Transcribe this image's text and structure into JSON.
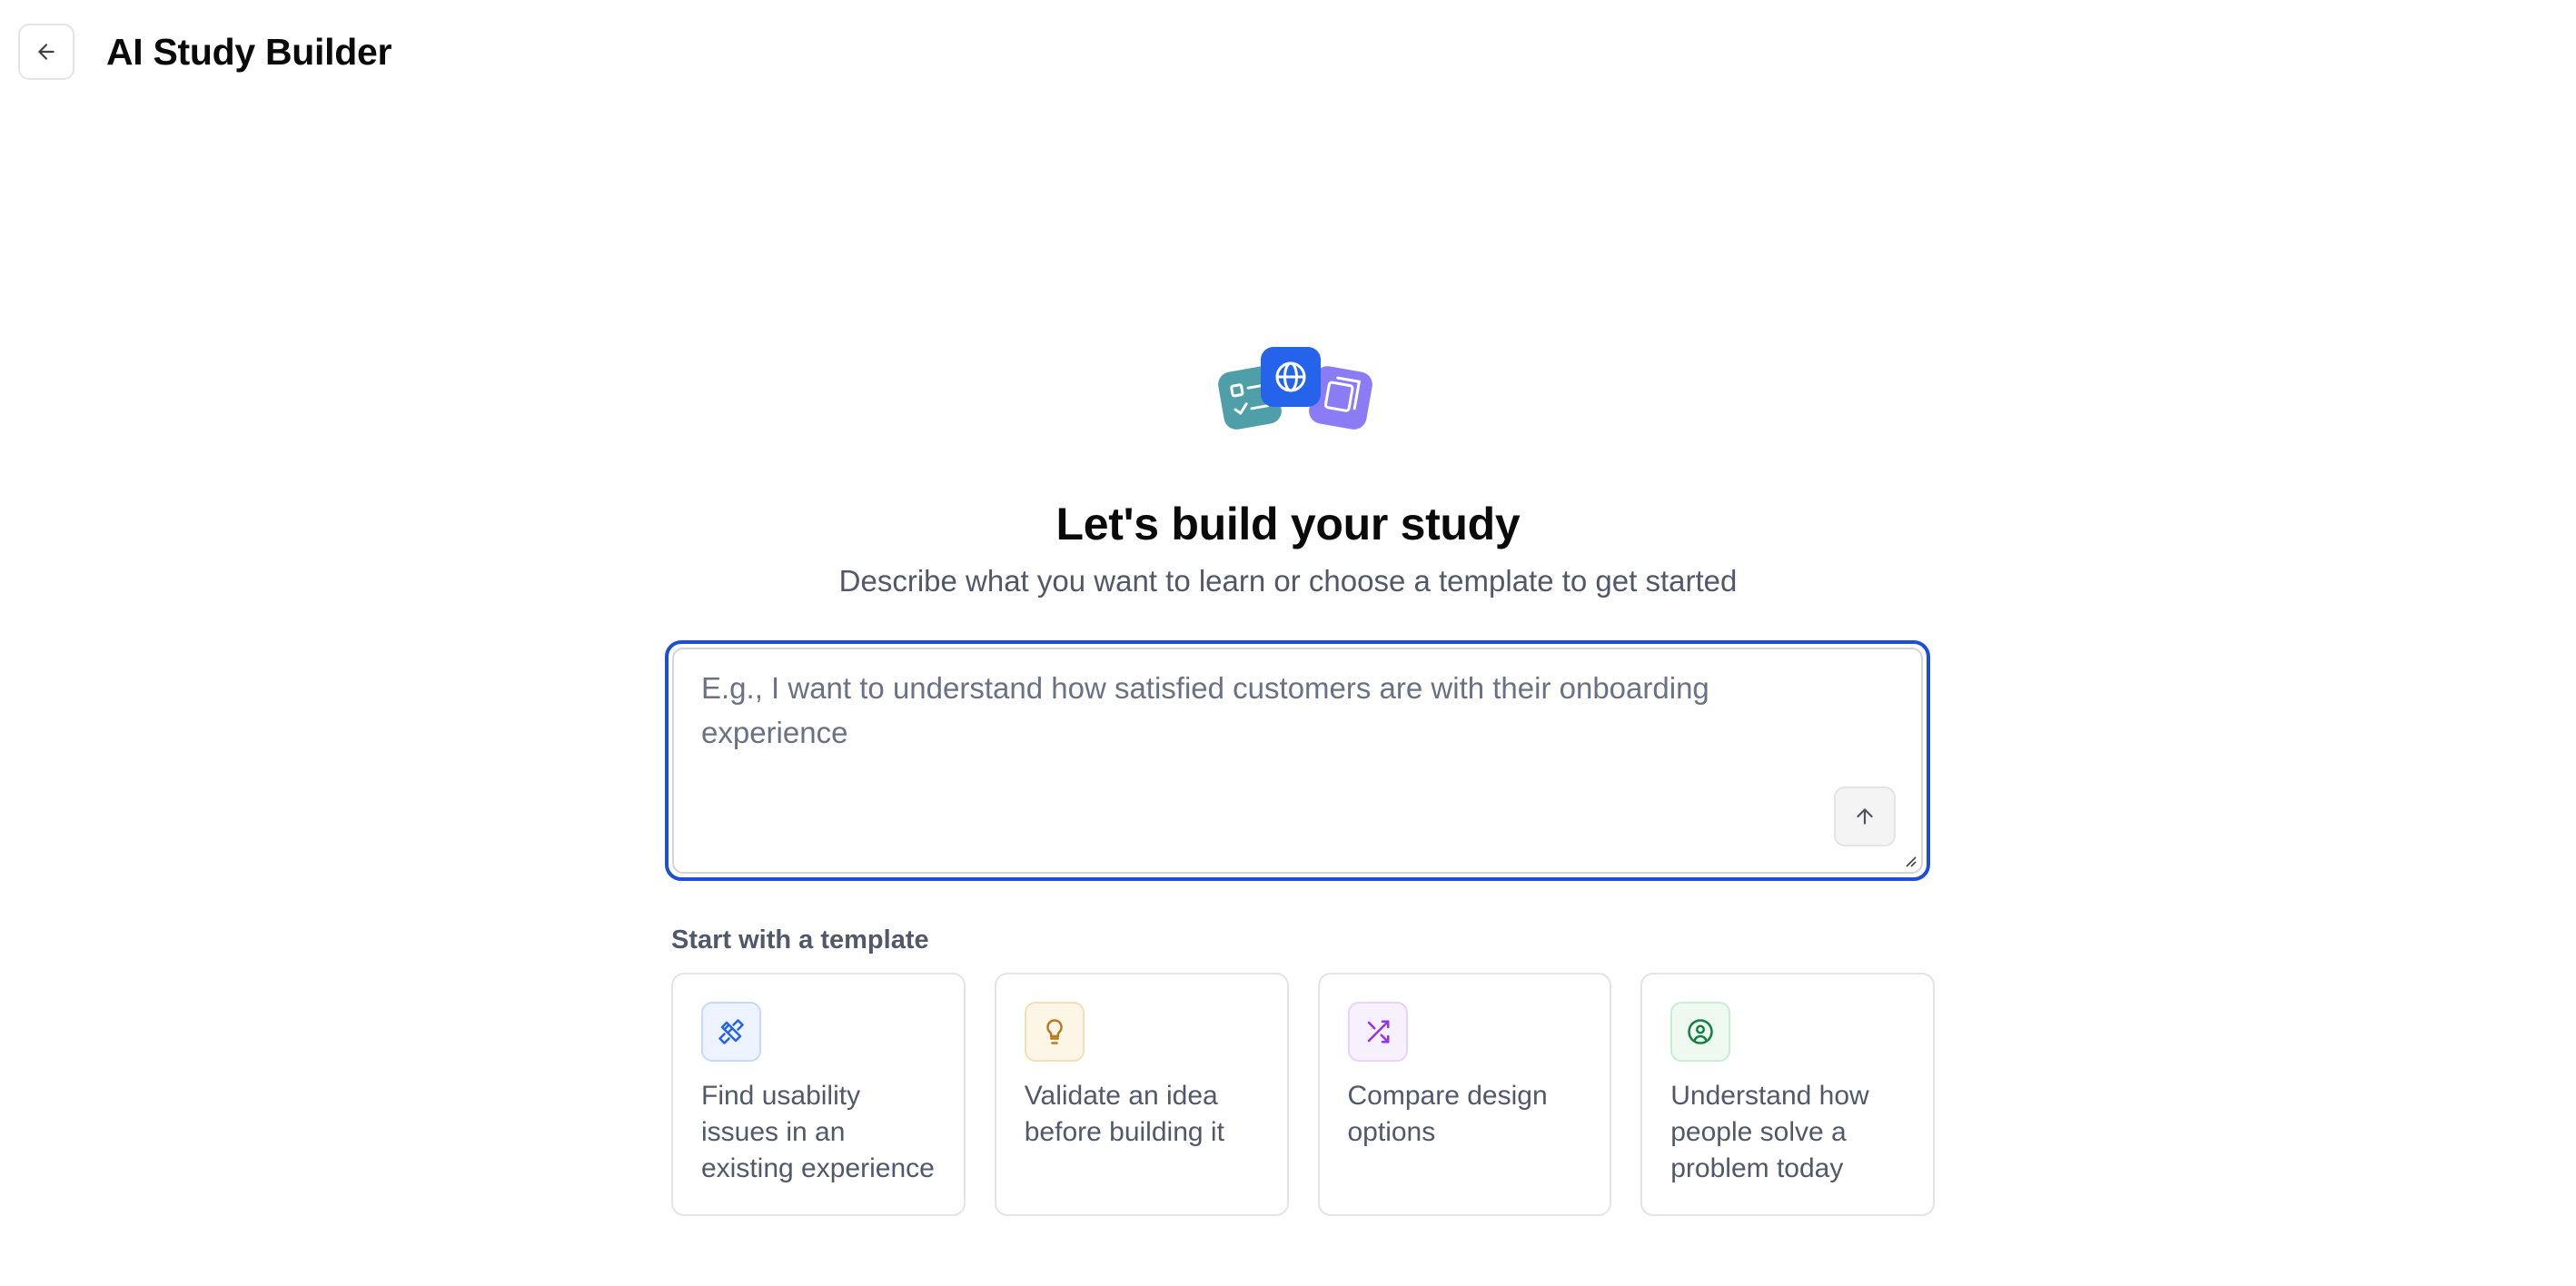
{
  "header": {
    "back_icon": "arrow-left-icon",
    "title": "AI Study Builder"
  },
  "hero": {
    "icons": [
      "checklist-icon",
      "globe-icon",
      "documents-icon"
    ],
    "colors": {
      "teal": "#4f9fa9",
      "blue": "#2563eb",
      "purple": "#8b7cf6"
    },
    "title": "Let's build your study",
    "subtitle": "Describe what you want to learn or choose a template to get started"
  },
  "prompt": {
    "value": "",
    "placeholder": "E.g., I want to understand how satisfied customers are with their onboarding experience",
    "submit_icon": "arrow-up-icon",
    "focus_color": "#1d4ed8"
  },
  "templates": {
    "label": "Start with a template",
    "items": [
      {
        "icon": "tools-icon",
        "label": "Find usability issues in an existing experience",
        "icon_color": "#2563eb",
        "bg": "#eef4ff",
        "border": "#c8d8fb"
      },
      {
        "icon": "lightbulb-icon",
        "label": "Validate an idea before building it",
        "icon_color": "#b7791f",
        "bg": "#fdf6e7",
        "border": "#f3dfb5"
      },
      {
        "icon": "shuffle-icon",
        "label": "Compare design options",
        "icon_color": "#9333ea",
        "bg": "#f7f0fe",
        "border": "#e6d4fb"
      },
      {
        "icon": "user-circle-icon",
        "label": "Understand how people solve a problem today",
        "icon_color": "#15803d",
        "bg": "#edf9f1",
        "border": "#c9ecd5"
      }
    ]
  }
}
